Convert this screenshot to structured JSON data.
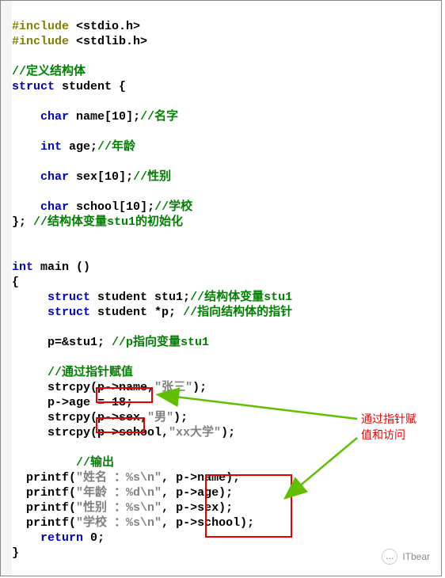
{
  "code": {
    "inc1_pp": "#include ",
    "inc1_lib": "<stdio.h>",
    "inc2_pp": "#include ",
    "inc2_lib": "<stdlib.h>",
    "cm_struct_def": "//定义结构体",
    "kw_struct": "struct",
    "id_student": " student {",
    "kw_char1": "char",
    "id_name": " name[",
    "sz10a": "10",
    "id_name_close": "];",
    "cm_name": "//名字",
    "kw_int_age": "int",
    "id_age": " age;",
    "cm_age": "//年龄",
    "kw_char2": "char",
    "id_sex": " sex[",
    "sz10b": "10",
    "id_sex_close": "];",
    "cm_sex": "//性别",
    "kw_char3": "char",
    "id_school": " school[",
    "sz10c": "10",
    "id_school_close": "];",
    "cm_school": "//学校",
    "id_close_brace": "}; ",
    "cm_stu1_init": "//结构体变量stu1的初始化",
    "kw_int_main": "int",
    "id_main": " main ()",
    "id_open_brace": "{",
    "kw_struct2": "struct",
    "id_stu1_decl": " student stu1;",
    "cm_stu1": "//结构体变量stu1",
    "kw_struct3": "struct",
    "id_p_decl": " student *p; ",
    "cm_p": "//指向结构体的指针",
    "id_passign": "p=&stu1; ",
    "cm_passign": "//p指向变量stu1",
    "cm_assign_via_ptr": "//通过指针赋值",
    "id_strcpy1a": "strcpy(",
    "id_strcpy1b": "p->name",
    "id_strcpy1c": ",",
    "str_zhangsan": "\"张三\"",
    "id_strcpy1d": ");",
    "id_age_assign": "p->age = ",
    "num18": "18",
    "id_semicolon1": ";",
    "id_strcpy2a": "strcpy(",
    "id_strcpy2b": "p->sex",
    "id_strcpy2c": ",",
    "str_nan": "\"男\"",
    "id_strcpy2d": ");",
    "id_strcpy3a": "strcpy(p->school,",
    "str_xxuni": "\"xx大学\"",
    "id_strcpy3b": ");",
    "cm_output": "//输出",
    "pf1a": "printf(",
    "pf1s": "\"姓名 ：%s\\n\"",
    "pf1b": ", ",
    "pf1c": "p->name);",
    "pf2a": "printf(",
    "pf2s": "\"年龄 ：%d\\n\"",
    "pf2b": ", ",
    "pf2c": "p->age);",
    "pf3a": "printf(",
    "pf3s": "\"性别 ：%s\\n\"",
    "pf3b": ", ",
    "pf3c": "p->sex);",
    "pf4a": "printf(",
    "pf4s": "\"学校 ：%s\\n\"",
    "pf4b": ", ",
    "pf4c": "p->school);",
    "kw_return": "return",
    "id_ret": " ",
    "num0": "0",
    "id_ret_semi": ";",
    "id_end_brace": "}"
  },
  "annotation": {
    "line1": "通过指针赋",
    "line2": "值和访问"
  },
  "watermark": {
    "text": "ITbear",
    "icon_glyph": "…"
  }
}
